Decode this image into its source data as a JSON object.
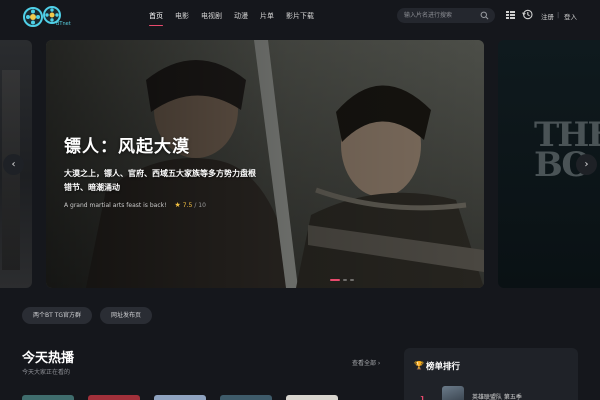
{
  "header": {
    "logo_text": "BTnet",
    "nav": [
      {
        "label": "首页",
        "active": true
      },
      {
        "label": "电影",
        "active": false
      },
      {
        "label": "电视剧",
        "active": false
      },
      {
        "label": "动漫",
        "active": false
      },
      {
        "label": "片单",
        "active": false
      },
      {
        "label": "影片下载",
        "active": false
      }
    ],
    "search_placeholder": "输入片名进行搜索",
    "login_label": "注册",
    "register_label": "登入",
    "icons": [
      "search-icon",
      "list-icon",
      "history-icon"
    ]
  },
  "carousel": {
    "title": "镖人：风起大漠",
    "desc_line1": "大漠之上，镖人、官府、西域五大家族等多方势力盘根",
    "desc_line2": "错节、暗潮涌动",
    "tagline": "A grand martial arts feast is back!",
    "rating": "7.5",
    "rating_scale": "/ 10",
    "prev_label": "‹",
    "next_label": "›",
    "dots": 3,
    "active_dot": 0
  },
  "pills": [
    {
      "label": "两个BT TG官方群"
    },
    {
      "label": "网址发布页"
    }
  ],
  "hot": {
    "title": "今天热播",
    "subtitle": "今天大家正在看的",
    "view_all": "查看全部 ›"
  },
  "ranking": {
    "title": "榜单排行",
    "first_num": "1",
    "first_name": "英雄联盟队 第五季"
  },
  "colors": {
    "accent": "#e84a6d",
    "background": "#15171c",
    "star": "#f5c242"
  }
}
